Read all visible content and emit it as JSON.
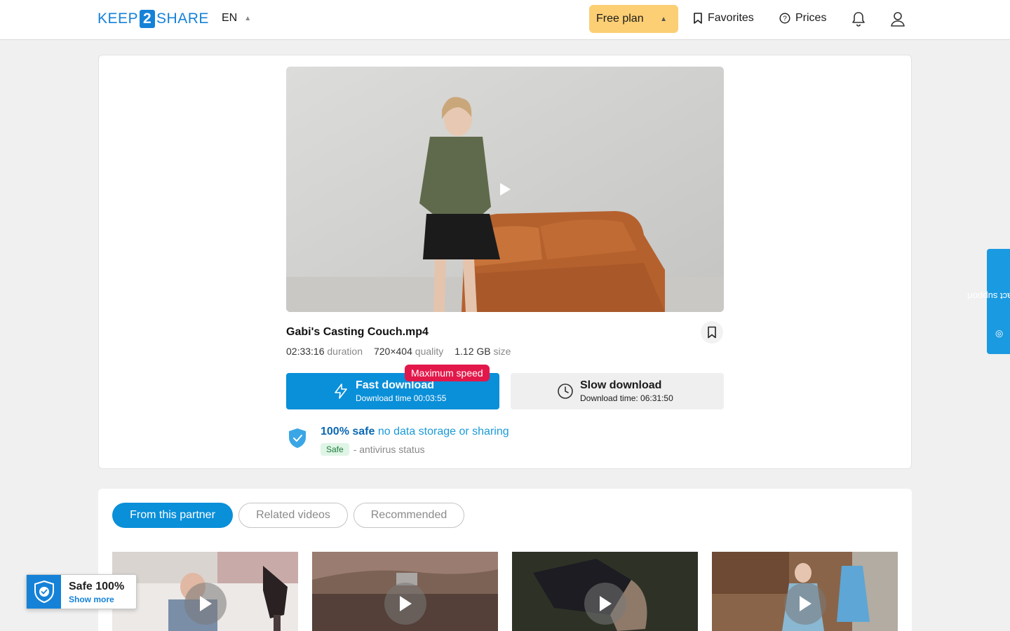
{
  "header": {
    "logo": {
      "part1": "KEEP",
      "part2": "2",
      "part3": "SHARE"
    },
    "language": "EN",
    "plan_label": "Free plan",
    "favorites_label": "Favorites",
    "prices_label": "Prices"
  },
  "file": {
    "title": "Gabi's Casting Couch.mp4",
    "duration_value": "02:33:16",
    "duration_label": "duration",
    "quality_value": "720×404",
    "quality_label": "quality",
    "size_value": "1.12 GB",
    "size_label": "size"
  },
  "downloads": {
    "fast_title": "Fast download",
    "fast_sub": "Download time 00:03:55",
    "badge": "Maximum speed",
    "slow_title": "Slow download",
    "slow_sub": "Download time: 06:31:50"
  },
  "safety": {
    "strong": "100% safe",
    "light": "no data storage or sharing",
    "pill": "Safe",
    "status": "- antivirus status"
  },
  "tabs": [
    {
      "label": "From this partner",
      "active": true
    },
    {
      "label": "Related videos",
      "active": false
    },
    {
      "label": "Recommended",
      "active": false
    }
  ],
  "widgets": {
    "contact_label": "contact support",
    "safe_title": "Safe 100%",
    "safe_link": "Show more"
  },
  "colors": {
    "brand_blue": "#0a8fd9",
    "plan_yellow": "#fccf74",
    "badge_red": "#e3184a"
  }
}
